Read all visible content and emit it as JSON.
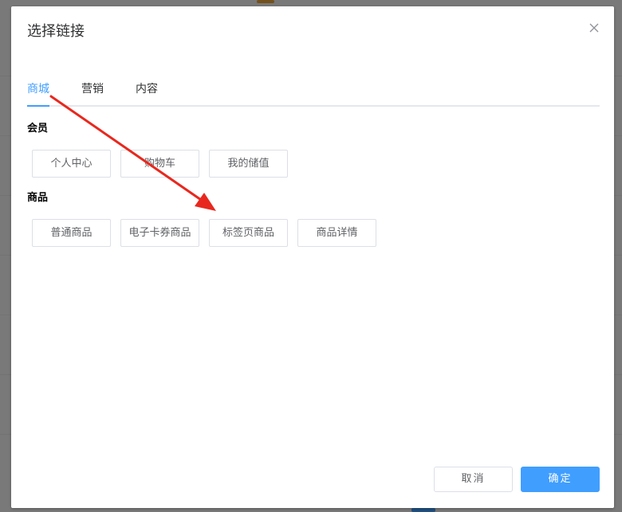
{
  "dialog": {
    "title": "选择链接",
    "close_icon": "close-icon"
  },
  "tabs": [
    {
      "label": "商城",
      "active": true
    },
    {
      "label": "营销",
      "active": false
    },
    {
      "label": "内容",
      "active": false
    }
  ],
  "sections": [
    {
      "title": "会员",
      "items": [
        "个人中心",
        "购物车",
        "我的储值"
      ]
    },
    {
      "title": "商品",
      "items": [
        "普通商品",
        "电子卡券商品",
        "标签页商品",
        "商品详情"
      ]
    }
  ],
  "footer": {
    "cancel_label": "取消",
    "confirm_label": "确定"
  },
  "colors": {
    "accent": "#409eff",
    "annotation_arrow": "#e8281e"
  }
}
